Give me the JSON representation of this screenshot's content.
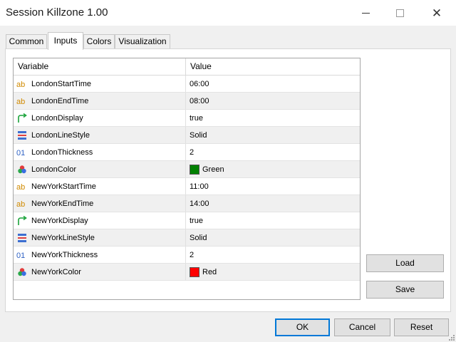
{
  "window": {
    "title": "Session Killzone 1.00"
  },
  "tabs": [
    {
      "label": "Common"
    },
    {
      "label": "Inputs"
    },
    {
      "label": "Colors"
    },
    {
      "label": "Visualization"
    }
  ],
  "active_tab": "Inputs",
  "grid": {
    "headers": {
      "variable": "Variable",
      "value": "Value"
    },
    "rows": [
      {
        "icon": "string-icon",
        "name": "LondonStartTime",
        "value": "06:00"
      },
      {
        "icon": "string-icon",
        "name": "LondonEndTime",
        "value": "08:00"
      },
      {
        "icon": "bool-arrow-icon",
        "name": "LondonDisplay",
        "value": "true"
      },
      {
        "icon": "line-style-icon",
        "name": "LondonLineStyle",
        "value": "Solid"
      },
      {
        "icon": "integer-icon",
        "name": "LondonThickness",
        "value": "2"
      },
      {
        "icon": "color-icon",
        "name": "LondonColor",
        "value": "Green",
        "swatch": "#008000"
      },
      {
        "icon": "string-icon",
        "name": "NewYorkStartTime",
        "value": "11:00"
      },
      {
        "icon": "string-icon",
        "name": "NewYorkEndTime",
        "value": "14:00"
      },
      {
        "icon": "bool-arrow-icon",
        "name": "NewYorkDisplay",
        "value": "true"
      },
      {
        "icon": "line-style-icon",
        "name": "NewYorkLineStyle",
        "value": "Solid"
      },
      {
        "icon": "integer-icon",
        "name": "NewYorkThickness",
        "value": "2"
      },
      {
        "icon": "color-icon",
        "name": "NewYorkColor",
        "value": "Red",
        "swatch": "#ff0000"
      }
    ]
  },
  "buttons": {
    "load": "Load",
    "save": "Save",
    "ok": "OK",
    "cancel": "Cancel",
    "reset": "Reset"
  },
  "colors": {
    "accent": "#0078d7",
    "row_alt": "#f0f0f0"
  }
}
